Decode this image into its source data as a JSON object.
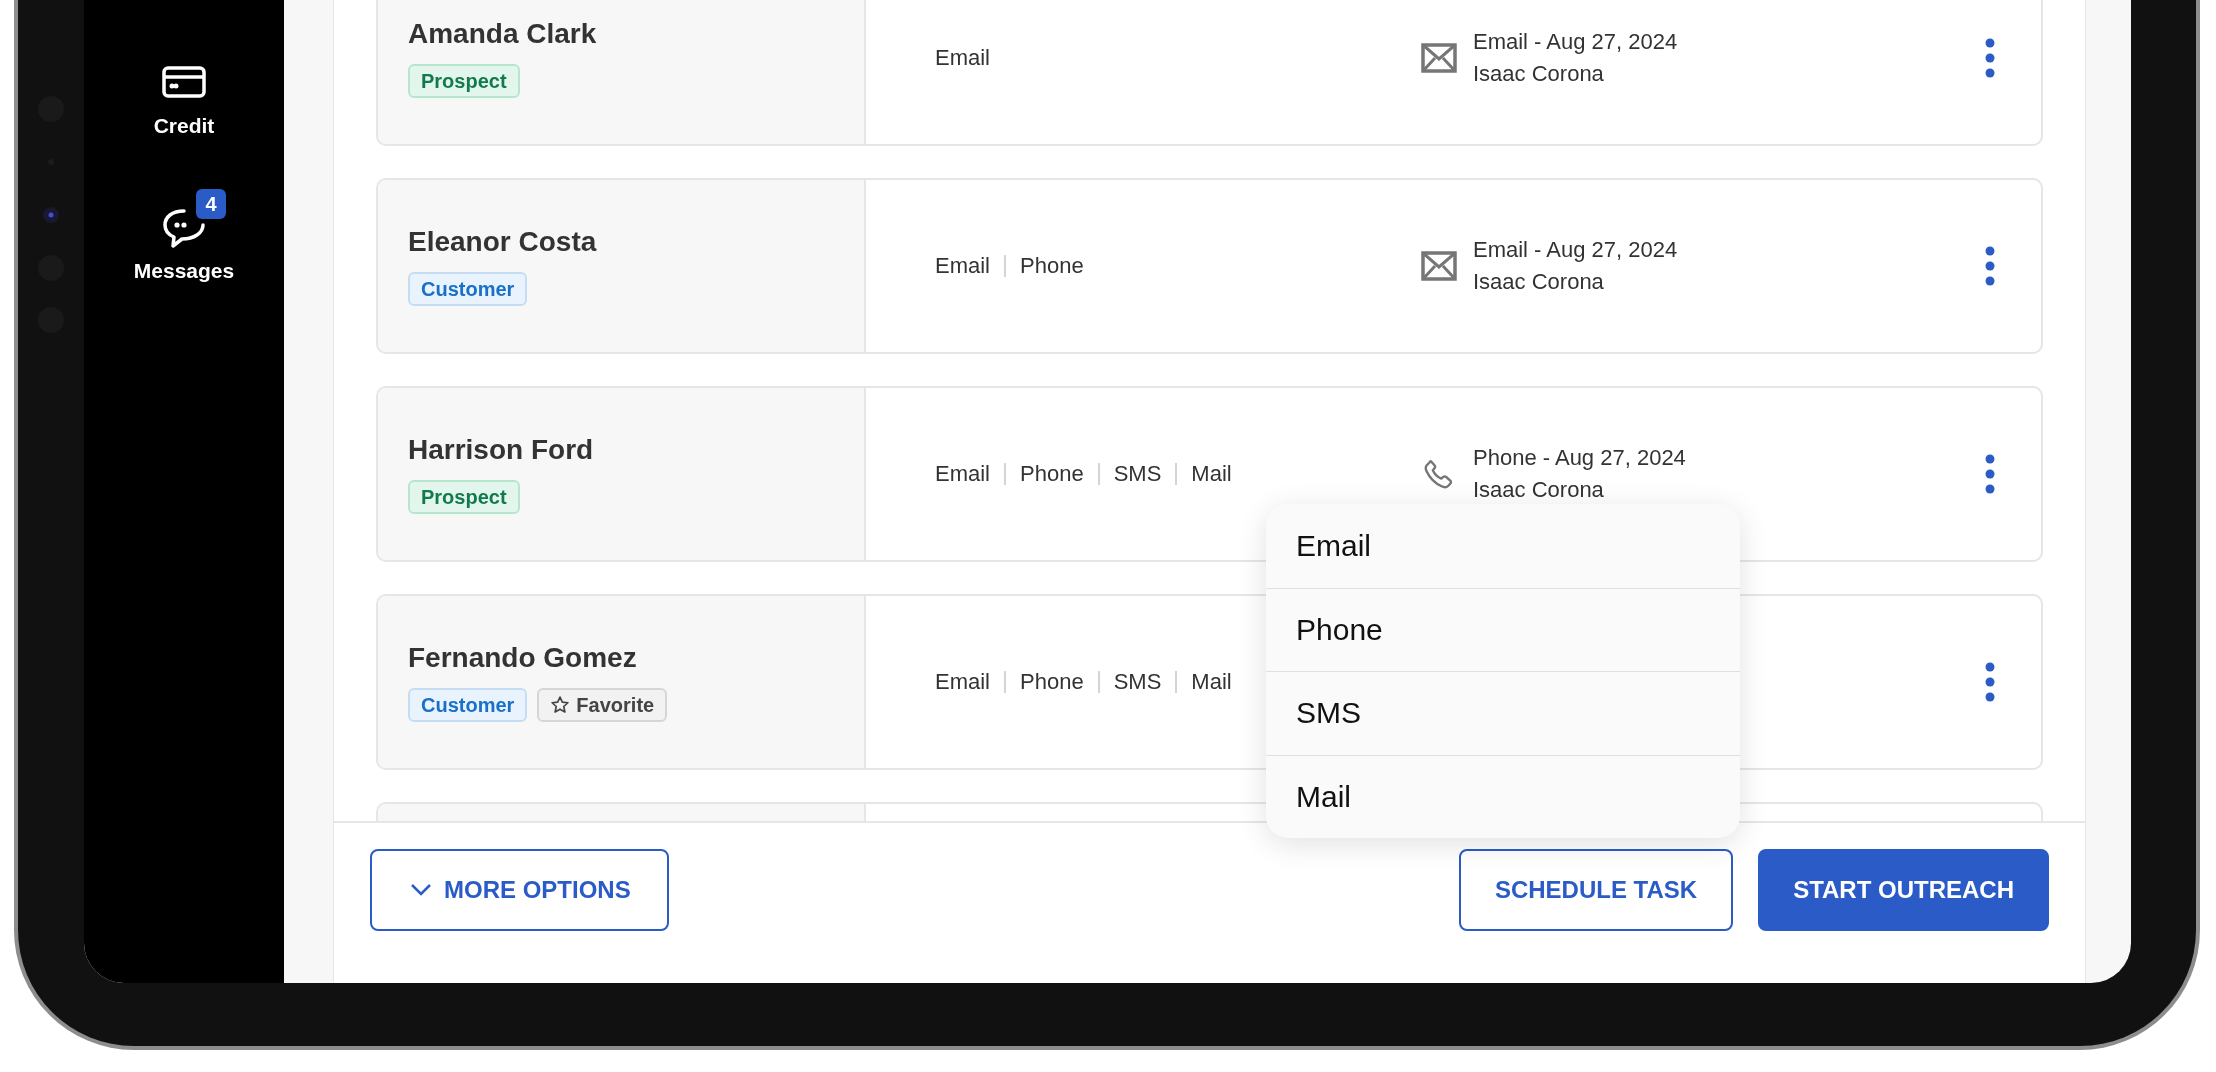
{
  "sidebar": {
    "items": [
      {
        "label": "Credit",
        "kind": "credit"
      },
      {
        "label": "Messages",
        "kind": "messages",
        "badge": "4"
      }
    ]
  },
  "contacts": [
    {
      "name": "Amanda Clark",
      "tags": [
        {
          "label": "Prospect",
          "kind": "prospect"
        }
      ],
      "channels": [
        "Email"
      ],
      "last_contact": {
        "kind": "email",
        "line_1": "Email - Aug 27, 2024",
        "line_2": "Isaac Corona"
      }
    },
    {
      "name": "Eleanor Costa",
      "tags": [
        {
          "label": "Customer",
          "kind": "customer"
        }
      ],
      "channels": [
        "Email",
        "Phone"
      ],
      "last_contact": {
        "kind": "email",
        "line_1": "Email - Aug 27, 2024",
        "line_2": "Isaac Corona"
      }
    },
    {
      "name": "Harrison Ford",
      "tags": [
        {
          "label": "Prospect",
          "kind": "prospect"
        }
      ],
      "channels": [
        "Email",
        "Phone",
        "SMS",
        "Mail"
      ],
      "last_contact": {
        "kind": "phone",
        "line_1": "Phone - Aug 27, 2024",
        "line_2": "Isaac Corona"
      }
    },
    {
      "name": "Fernando Gomez",
      "tags": [
        {
          "label": "Customer",
          "kind": "customer"
        },
        {
          "label": "Favorite",
          "kind": "favorite"
        }
      ],
      "channels": [
        "Email",
        "Phone",
        "SMS",
        "Mail"
      ]
    }
  ],
  "menu": {
    "items": [
      "Email",
      "Phone",
      "SMS",
      "Mail"
    ]
  },
  "footer": {
    "buttons": [
      {
        "label": "MORE OPTIONS",
        "kind": "dropdown"
      },
      {
        "label": "SCHEDULE TASK",
        "kind": "outline"
      },
      {
        "label": "START OUTREACH",
        "kind": "primary"
      }
    ]
  }
}
